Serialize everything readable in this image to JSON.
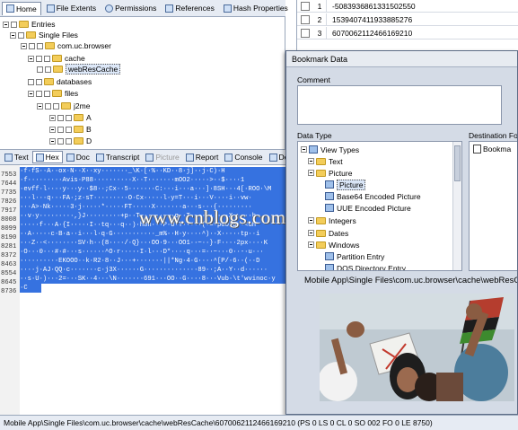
{
  "top_tabs": [
    {
      "label": "Home",
      "active": true
    },
    {
      "label": "File Extents",
      "active": false
    },
    {
      "label": "Permissions",
      "active": false
    },
    {
      "label": "References",
      "active": false
    },
    {
      "label": "Hash Properties",
      "active": false
    }
  ],
  "tree": {
    "entries": "Entries",
    "single_files": "Single Files",
    "com_uc_browser": "com.uc.browser",
    "cache": "cache",
    "webrescache": "webResCache",
    "databases": "databases",
    "files": "files",
    "j2me": "j2me",
    "a": "A",
    "b": "B",
    "d": "D"
  },
  "grid_rows": [
    {
      "num": "1",
      "value": "-5083936861331502550"
    },
    {
      "num": "2",
      "value": "1539407411933885276"
    },
    {
      "num": "3",
      "value": "6070062112466169210"
    }
  ],
  "hex_tabs": [
    {
      "label": "Text",
      "active": false,
      "disabled": false
    },
    {
      "label": "Hex",
      "active": true,
      "disabled": false
    },
    {
      "label": "Doc",
      "active": false,
      "disabled": false
    },
    {
      "label": "Transcript",
      "active": false,
      "disabled": false
    },
    {
      "label": "Picture",
      "active": false,
      "disabled": true
    },
    {
      "label": "Report",
      "active": false,
      "disabled": false
    },
    {
      "label": "Console",
      "active": false,
      "disabled": false
    },
    {
      "label": "De",
      "active": false,
      "disabled": false
    }
  ],
  "hex_lines": [
    {
      "num": "7553",
      "bytes": "·f·fS··A··ox·N··X··xy·······_\\K·[·%··KD··8·j]··j·C)·H"
    },
    {
      "num": "7644",
      "bytes": "·f·········Avis·P88··········X··T·······mOO2·····>··$····1"
    },
    {
      "num": "7735",
      "bytes": "·evff·l····y···y··$8··;Cx··5·······C:···i···a···]·8SH···4[·ROO·\\M"
    },
    {
      "num": "7826",
      "bytes": "···l···q···FA·;z·sT·········O·Cx·····l·y=T···i···V····i··vw·"
    },
    {
      "num": "7917",
      "bytes": "···A>·Nk·····3·j·····*·····FT·····X·······a···s···{·········"
    },
    {
      "num": "8008",
      "bytes": "··v·y·········,}J·········+p··T·········q··T··········X·····h·"
    },
    {
      "num": "8099",
      "bytes": "·····f···A·{I·····I··tq···q··)·h8h···P·U·T·····(·=·p0O\"q··<uh"
    },
    {
      "num": "8190",
      "bytes": "··A·····c·B·a··i···l·q·G···········_m%··H·y····^)··X·····tp··i"
    },
    {
      "num": "8281",
      "bytes": "···Z··<········SV·h··(8····/·Q}···OO·9···OO1··~··}·F····2px····K"
    },
    {
      "num": "8372",
      "bytes": "·O···0···#·#···s······^O·r·····I·l···D*····q···=··~···0··-·u···"
    },
    {
      "num": "8463",
      "bytes": "··········EKOOO··k·R2·8··J···+·······||*Ng·4·G····^[P/·6··(··D"
    },
    {
      "num": "8554",
      "bytes": "····j·AJ·QQ·c·······c·j3X······G··············89··;A··Y··d······"
    },
    {
      "num": "8645",
      "bytes": "··s·U·)···2=···SK··4···\\N·······691···OO··G····8···Vub·\\t'wvinoc·y"
    },
    {
      "num": "8736",
      "bytes": "·C"
    }
  ],
  "watermark": "www.cnblogs.com/ysun",
  "dialog": {
    "title": "Bookmark Data",
    "comment_label": "Comment",
    "comment_value": "",
    "datatype_label": "Data Type",
    "destination_label": "Destination Fo",
    "destination_item": "Bookma",
    "types": {
      "view_types": "View Types",
      "text": "Text",
      "picture": "Picture",
      "picture_child": "Picture",
      "base64": "Base64 Encoded Picture",
      "uue": "UUE Encoded Picture",
      "integers": "Integers",
      "dates": "Dates",
      "windows": "Windows",
      "partition_entry": "Partition Entry",
      "dos_directory_entry": "DOS Directory Entry"
    },
    "path_label": "Mobile App\\Single Files\\com.uc.browser\\cache\\webResCache"
  },
  "statusbar": "Mobile App\\Single Files\\com.uc.browser\\cache\\webResCache\\6070062112466169210 (PS 0 LS 0 CL 0 SO 002 FO 0 LE 8750)",
  "colors": {
    "selection": "#3672e0",
    "chrome": "#e6ebf3",
    "dialog_bg": "#d4dbe6",
    "folder": "#f3cd5a"
  },
  "icons": [
    "home-icon",
    "folder-icon",
    "checkbox-icon",
    "expander-icon",
    "picture-icon",
    "book-icon"
  ]
}
